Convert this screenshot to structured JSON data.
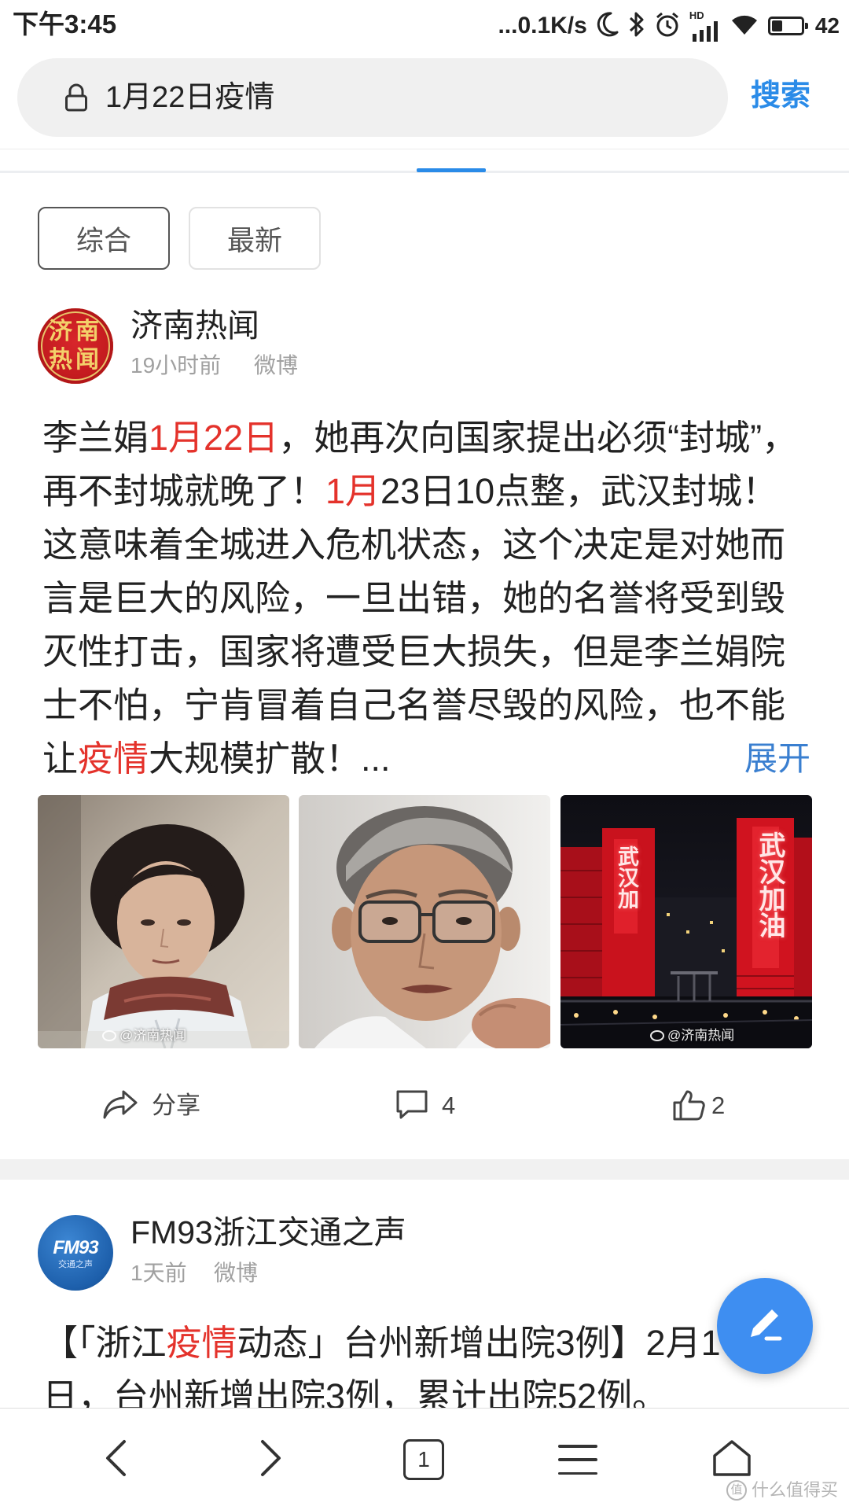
{
  "status_bar": {
    "time": "下午3:45",
    "network_speed": "...0.1K/s",
    "hd_label": "HD",
    "battery_level": "42"
  },
  "search": {
    "query": "1月22日疫情",
    "submit_label": "搜索"
  },
  "filters": [
    {
      "label": "综合",
      "selected": true
    },
    {
      "label": "最新",
      "selected": false
    }
  ],
  "posts": [
    {
      "author": "济南热闻",
      "avatar_lines": [
        "济南",
        "热闻"
      ],
      "time": "19小时前",
      "source": "微博",
      "lines": [
        [
          {
            "text": "李兰娟"
          },
          {
            "text": "1月22日",
            "highlight": true
          },
          {
            "text": "，她再次向国家提出必须“封城”，"
          }
        ],
        [
          {
            "text": "再不封城就晚了！"
          },
          {
            "text": "1月",
            "highlight": true
          },
          {
            "text": "23日10点整，武汉封城！"
          }
        ],
        [
          {
            "text": "这意味着全城进入危机状态，这个决定是对她而"
          }
        ],
        [
          {
            "text": "言是巨大的风险，一旦出错，她的名誉将受到毁"
          }
        ],
        [
          {
            "text": "灭性打击，国家将遭受巨大损失，但是李兰娟院"
          }
        ],
        [
          {
            "text": "士不怕，宁肯冒着自己名誉尽毁的风险，也不能"
          }
        ],
        [
          {
            "text": "让"
          },
          {
            "text": "疫情",
            "highlight": true
          },
          {
            "text": "大规模扩散！..."
          }
        ]
      ],
      "expand_label": "展开",
      "images": [
        {
          "watermark": "@济南热闻"
        },
        {},
        {
          "watermark": "@济南热闻",
          "signs": [
            "武汉加",
            "武汉加油"
          ]
        }
      ],
      "actions": {
        "share_label": "分享",
        "comment_count": "4",
        "like_count": "2"
      }
    },
    {
      "author": "FM93浙江交通之声",
      "avatar_logo": "FM93",
      "avatar_subtitle": "交通之声",
      "time": "1天前",
      "source": "微博",
      "lines": [
        [
          {
            "text": "【「浙江"
          },
          {
            "text": "疫情",
            "highlight": true
          },
          {
            "text": "动态」台州新增出院3例】2月1"
          }
        ],
        [
          {
            "text": "日，台州新增出院3例，累计出院52例。"
          }
        ]
      ]
    }
  ],
  "bottom_nav": {
    "tab_count": "1"
  },
  "site_watermark": {
    "badge": "值",
    "brand": "什么值得买"
  },
  "colors": {
    "accent": "#2a8be8",
    "highlight": "#e4322b",
    "fab": "#3e8ef1",
    "avatar_red": "#c41b1f",
    "avatar_blue": "#1d5fab"
  }
}
